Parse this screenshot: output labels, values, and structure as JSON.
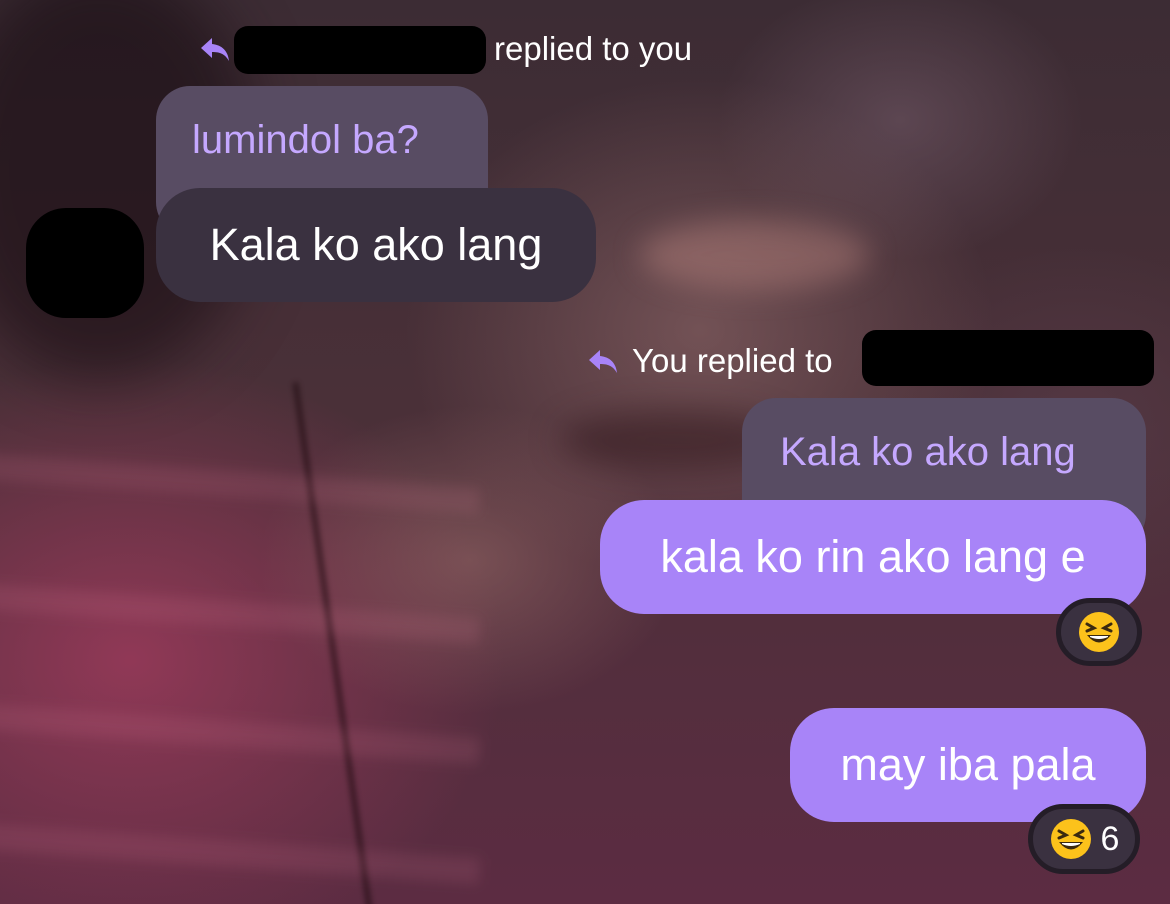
{
  "thread": [
    {
      "header_text": "replied to you",
      "quoted_text": "lumindol ba?",
      "message_text": "Kala ko ako lang",
      "direction": "incoming"
    },
    {
      "header_text": "You replied to",
      "quoted_text": "Kala ko ako lang",
      "message_text": "kala ko rin ako lang e",
      "direction": "outgoing",
      "reaction": {
        "emoji": "grinning-squinting-face",
        "count": ""
      }
    },
    {
      "message_text": "may iba pala",
      "direction": "outgoing",
      "reaction": {
        "emoji": "grinning-squinting-face",
        "count": "6"
      }
    }
  ],
  "colors": {
    "accent": "#a884f8",
    "quoted_text": "#c5a8ff",
    "incoming_bubble": "#3a3140",
    "quoted_bubble": "#584c63"
  }
}
